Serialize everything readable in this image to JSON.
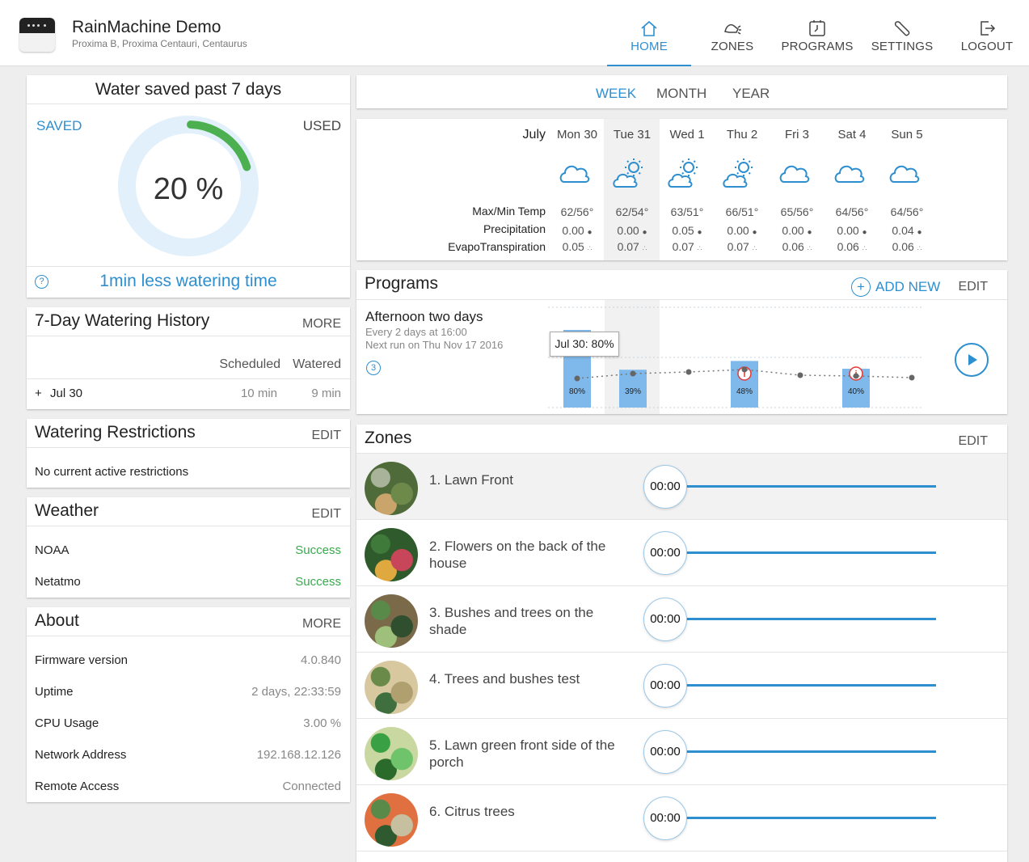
{
  "header": {
    "title": "RainMachine Demo",
    "subtitle": "Proxima B, Proxima Centauri, Centaurus",
    "nav": [
      {
        "label": "HOME",
        "icon": "home-icon",
        "active": true
      },
      {
        "label": "ZONES",
        "icon": "sprinkler-icon",
        "active": false
      },
      {
        "label": "PROGRAMS",
        "icon": "clock-icon",
        "active": false
      },
      {
        "label": "SETTINGS",
        "icon": "wrench-icon",
        "active": false
      },
      {
        "label": "LOGOUT",
        "icon": "logout-icon",
        "active": false
      }
    ]
  },
  "water_saved": {
    "title": "Water saved past 7 days",
    "saved_label": "SAVED",
    "used_label": "USED",
    "percent_text": "20 %",
    "saved_fraction": 0.2,
    "footer": "1min less watering time",
    "help_icon": "question-icon"
  },
  "history": {
    "title": "7-Day Watering History",
    "more": "MORE",
    "col_scheduled": "Scheduled",
    "col_watered": "Watered",
    "rows": [
      {
        "expand": "+",
        "date": "Jul 30",
        "scheduled": "10 min",
        "watered": "9 min"
      }
    ]
  },
  "restrictions": {
    "title": "Watering Restrictions",
    "edit": "EDIT",
    "text": "No current active restrictions"
  },
  "weather_sources": {
    "title": "Weather",
    "edit": "EDIT",
    "rows": [
      {
        "name": "NOAA",
        "status": "Success"
      },
      {
        "name": "Netatmo",
        "status": "Success"
      }
    ],
    "status_color": "#3aa94e"
  },
  "about": {
    "title": "About",
    "more": "MORE",
    "rows": [
      {
        "label": "Firmware version",
        "value": "4.0.840"
      },
      {
        "label": "Uptime",
        "value": "2 days, 22:33:59"
      },
      {
        "label": "CPU Usage",
        "value": "3.00 %"
      },
      {
        "label": "Network Address",
        "value": "192.168.12.126"
      },
      {
        "label": "Remote Access",
        "value": "Connected"
      }
    ]
  },
  "period_tabs": {
    "week": "WEEK",
    "month": "MONTH",
    "year": "YEAR",
    "active": "WEEK"
  },
  "forecast": {
    "month": "July",
    "labels": {
      "temp": "Max/Min Temp",
      "precip": "Precipitation",
      "et": "EvapoTranspiration"
    },
    "days": [
      {
        "name": "Mon 30",
        "icon": "cloud-icon",
        "temp": "62/56°",
        "precip": "0.00",
        "et": "0.05"
      },
      {
        "name": "Tue 31",
        "icon": "partly-sunny-icon",
        "temp": "62/54°",
        "precip": "0.00",
        "et": "0.07",
        "highlight": true
      },
      {
        "name": "Wed 1",
        "icon": "partly-sunny-icon",
        "temp": "63/51°",
        "precip": "0.05",
        "et": "0.07"
      },
      {
        "name": "Thu 2",
        "icon": "partly-sunny-icon",
        "temp": "66/51°",
        "precip": "0.00",
        "et": "0.07"
      },
      {
        "name": "Fri 3",
        "icon": "cloud-icon",
        "temp": "65/56°",
        "precip": "0.00",
        "et": "0.06"
      },
      {
        "name": "Sat 4",
        "icon": "cloud-icon",
        "temp": "64/56°",
        "precip": "0.00",
        "et": "0.06"
      },
      {
        "name": "Sun 5",
        "icon": "cloud-icon",
        "temp": "64/56°",
        "precip": "0.04",
        "et": "0.06"
      }
    ]
  },
  "programs": {
    "title": "Programs",
    "add_new": "ADD NEW",
    "edit": "EDIT",
    "items": [
      {
        "name": "Afternoon two days",
        "schedule": "Every 2 days at 16:00",
        "next_run": "Next run on Thu Nov 17 2016",
        "zones_count": "3",
        "tooltip": "Jul 30: 80%",
        "run_icon": "play-icon",
        "bars": [
          {
            "label": "80%",
            "value": 80,
            "warning": false
          },
          {
            "label": "39%",
            "value": 39,
            "warning": false
          },
          {
            "label": "48%",
            "value": 48,
            "warning": true
          },
          {
            "label": "40%",
            "value": 40,
            "warning": true
          }
        ]
      }
    ]
  },
  "zones": {
    "title": "Zones",
    "edit": "EDIT",
    "items": [
      {
        "name": "1. Lawn Front",
        "timer": "00:00"
      },
      {
        "name": "2. Flowers on the back of the house",
        "timer": "00:00"
      },
      {
        "name": "3. Bushes and trees on the shade",
        "timer": "00:00"
      },
      {
        "name": "4. Trees and bushes test",
        "timer": "00:00"
      },
      {
        "name": "5. Lawn green front side of the porch",
        "timer": "00:00"
      },
      {
        "name": "6. Citrus trees",
        "timer": "00:00"
      }
    ]
  },
  "colors": {
    "accent": "#2d8fd0",
    "gauge_track": "#e1f0fb",
    "gauge_saved": "#4caf50",
    "bar": "#7fb8ea",
    "warning": "#e53935"
  }
}
